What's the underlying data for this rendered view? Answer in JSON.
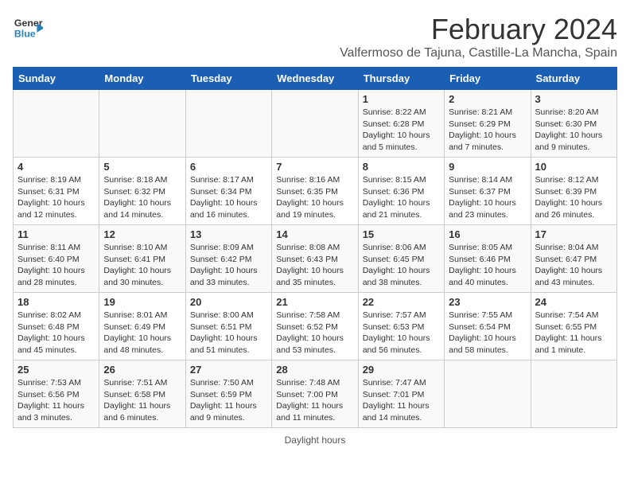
{
  "header": {
    "logo_top": "General",
    "logo_bot": "Blue",
    "title": "February 2024",
    "subtitle": "Valfermoso de Tajuna, Castille-La Mancha, Spain"
  },
  "days_of_week": [
    "Sunday",
    "Monday",
    "Tuesday",
    "Wednesday",
    "Thursday",
    "Friday",
    "Saturday"
  ],
  "footer": {
    "note": "Daylight hours"
  },
  "weeks": [
    [
      {
        "num": "",
        "info": ""
      },
      {
        "num": "",
        "info": ""
      },
      {
        "num": "",
        "info": ""
      },
      {
        "num": "",
        "info": ""
      },
      {
        "num": "1",
        "info": "Sunrise: 8:22 AM\nSunset: 6:28 PM\nDaylight: 10 hours\nand 5 minutes."
      },
      {
        "num": "2",
        "info": "Sunrise: 8:21 AM\nSunset: 6:29 PM\nDaylight: 10 hours\nand 7 minutes."
      },
      {
        "num": "3",
        "info": "Sunrise: 8:20 AM\nSunset: 6:30 PM\nDaylight: 10 hours\nand 9 minutes."
      }
    ],
    [
      {
        "num": "4",
        "info": "Sunrise: 8:19 AM\nSunset: 6:31 PM\nDaylight: 10 hours\nand 12 minutes."
      },
      {
        "num": "5",
        "info": "Sunrise: 8:18 AM\nSunset: 6:32 PM\nDaylight: 10 hours\nand 14 minutes."
      },
      {
        "num": "6",
        "info": "Sunrise: 8:17 AM\nSunset: 6:34 PM\nDaylight: 10 hours\nand 16 minutes."
      },
      {
        "num": "7",
        "info": "Sunrise: 8:16 AM\nSunset: 6:35 PM\nDaylight: 10 hours\nand 19 minutes."
      },
      {
        "num": "8",
        "info": "Sunrise: 8:15 AM\nSunset: 6:36 PM\nDaylight: 10 hours\nand 21 minutes."
      },
      {
        "num": "9",
        "info": "Sunrise: 8:14 AM\nSunset: 6:37 PM\nDaylight: 10 hours\nand 23 minutes."
      },
      {
        "num": "10",
        "info": "Sunrise: 8:12 AM\nSunset: 6:39 PM\nDaylight: 10 hours\nand 26 minutes."
      }
    ],
    [
      {
        "num": "11",
        "info": "Sunrise: 8:11 AM\nSunset: 6:40 PM\nDaylight: 10 hours\nand 28 minutes."
      },
      {
        "num": "12",
        "info": "Sunrise: 8:10 AM\nSunset: 6:41 PM\nDaylight: 10 hours\nand 30 minutes."
      },
      {
        "num": "13",
        "info": "Sunrise: 8:09 AM\nSunset: 6:42 PM\nDaylight: 10 hours\nand 33 minutes."
      },
      {
        "num": "14",
        "info": "Sunrise: 8:08 AM\nSunset: 6:43 PM\nDaylight: 10 hours\nand 35 minutes."
      },
      {
        "num": "15",
        "info": "Sunrise: 8:06 AM\nSunset: 6:45 PM\nDaylight: 10 hours\nand 38 minutes."
      },
      {
        "num": "16",
        "info": "Sunrise: 8:05 AM\nSunset: 6:46 PM\nDaylight: 10 hours\nand 40 minutes."
      },
      {
        "num": "17",
        "info": "Sunrise: 8:04 AM\nSunset: 6:47 PM\nDaylight: 10 hours\nand 43 minutes."
      }
    ],
    [
      {
        "num": "18",
        "info": "Sunrise: 8:02 AM\nSunset: 6:48 PM\nDaylight: 10 hours\nand 45 minutes."
      },
      {
        "num": "19",
        "info": "Sunrise: 8:01 AM\nSunset: 6:49 PM\nDaylight: 10 hours\nand 48 minutes."
      },
      {
        "num": "20",
        "info": "Sunrise: 8:00 AM\nSunset: 6:51 PM\nDaylight: 10 hours\nand 51 minutes."
      },
      {
        "num": "21",
        "info": "Sunrise: 7:58 AM\nSunset: 6:52 PM\nDaylight: 10 hours\nand 53 minutes."
      },
      {
        "num": "22",
        "info": "Sunrise: 7:57 AM\nSunset: 6:53 PM\nDaylight: 10 hours\nand 56 minutes."
      },
      {
        "num": "23",
        "info": "Sunrise: 7:55 AM\nSunset: 6:54 PM\nDaylight: 10 hours\nand 58 minutes."
      },
      {
        "num": "24",
        "info": "Sunrise: 7:54 AM\nSunset: 6:55 PM\nDaylight: 11 hours\nand 1 minute."
      }
    ],
    [
      {
        "num": "25",
        "info": "Sunrise: 7:53 AM\nSunset: 6:56 PM\nDaylight: 11 hours\nand 3 minutes."
      },
      {
        "num": "26",
        "info": "Sunrise: 7:51 AM\nSunset: 6:58 PM\nDaylight: 11 hours\nand 6 minutes."
      },
      {
        "num": "27",
        "info": "Sunrise: 7:50 AM\nSunset: 6:59 PM\nDaylight: 11 hours\nand 9 minutes."
      },
      {
        "num": "28",
        "info": "Sunrise: 7:48 AM\nSunset: 7:00 PM\nDaylight: 11 hours\nand 11 minutes."
      },
      {
        "num": "29",
        "info": "Sunrise: 7:47 AM\nSunset: 7:01 PM\nDaylight: 11 hours\nand 14 minutes."
      },
      {
        "num": "",
        "info": ""
      },
      {
        "num": "",
        "info": ""
      }
    ]
  ]
}
